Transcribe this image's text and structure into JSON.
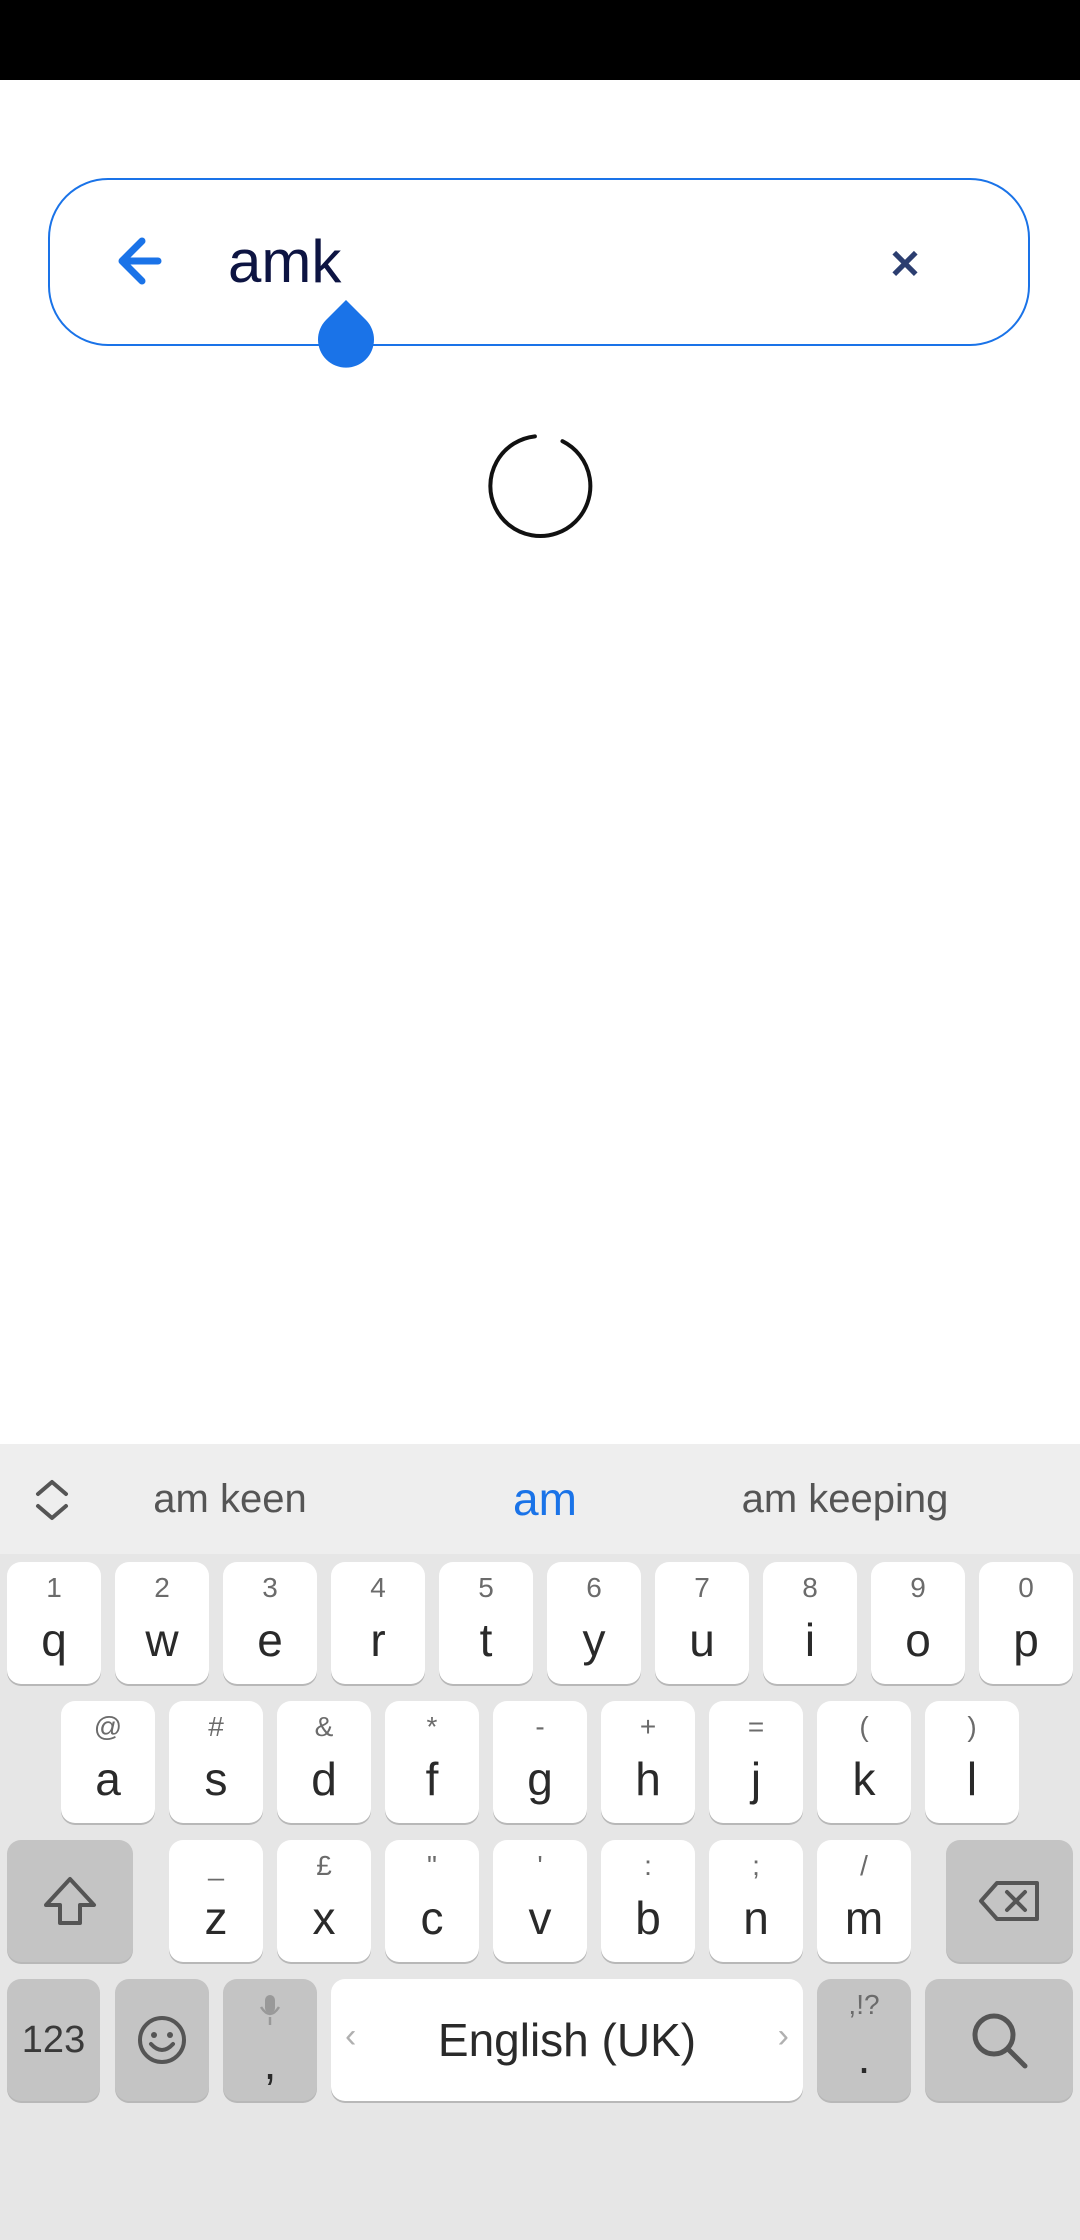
{
  "search": {
    "query": "amk"
  },
  "keyboard": {
    "suggestions": [
      "am keen",
      "am",
      "am keeping"
    ],
    "row1": [
      {
        "sec": "1",
        "pri": "q"
      },
      {
        "sec": "2",
        "pri": "w"
      },
      {
        "sec": "3",
        "pri": "e"
      },
      {
        "sec": "4",
        "pri": "r"
      },
      {
        "sec": "5",
        "pri": "t"
      },
      {
        "sec": "6",
        "pri": "y"
      },
      {
        "sec": "7",
        "pri": "u"
      },
      {
        "sec": "8",
        "pri": "i"
      },
      {
        "sec": "9",
        "pri": "o"
      },
      {
        "sec": "0",
        "pri": "p"
      }
    ],
    "row2": [
      {
        "sec": "@",
        "pri": "a"
      },
      {
        "sec": "#",
        "pri": "s"
      },
      {
        "sec": "&",
        "pri": "d"
      },
      {
        "sec": "*",
        "pri": "f"
      },
      {
        "sec": "-",
        "pri": "g"
      },
      {
        "sec": "+",
        "pri": "h"
      },
      {
        "sec": "=",
        "pri": "j"
      },
      {
        "sec": "(",
        "pri": "k"
      },
      {
        "sec": ")",
        "pri": "l"
      }
    ],
    "row3": [
      {
        "sec": "_",
        "pri": "z"
      },
      {
        "sec": "£",
        "pri": "x"
      },
      {
        "sec": "\"",
        "pri": "c"
      },
      {
        "sec": "'",
        "pri": "v"
      },
      {
        "sec": ":",
        "pri": "b"
      },
      {
        "sec": ";",
        "pri": "n"
      },
      {
        "sec": "/",
        "pri": "m"
      }
    ],
    "numbers_key": "123",
    "comma_key": ",",
    "space_label": "English (UK)",
    "period_key": ".",
    "period_sec": ",!?"
  },
  "colors": {
    "accent": "#1a73e8",
    "query_text": "#0d1442"
  },
  "icons": [
    "back-arrow-icon",
    "clear-icon",
    "cursor-handle",
    "loading-spinner",
    "shift-icon",
    "backspace-icon",
    "emoji-icon",
    "mic-icon",
    "search-icon",
    "suggestion-expand-icon"
  ]
}
